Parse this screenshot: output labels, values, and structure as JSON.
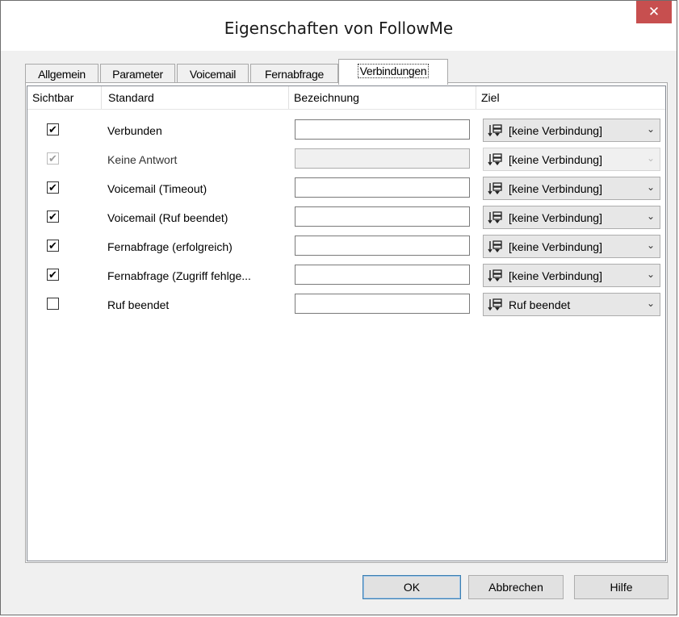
{
  "window": {
    "title": "Eigenschaften von FollowMe",
    "close_label": "✕"
  },
  "tabs": [
    {
      "label": "Allgemein"
    },
    {
      "label": "Parameter"
    },
    {
      "label": "Voicemail"
    },
    {
      "label": "Fernabfrage"
    },
    {
      "label": "Verbindungen"
    }
  ],
  "active_tab": "Verbindungen",
  "columns": {
    "visible": "Sichtbar",
    "standard": "Standard",
    "label": "Bezeichnung",
    "target": "Ziel"
  },
  "rows": [
    {
      "checked": true,
      "enabled": true,
      "check_mark": "✔",
      "standard": "Verbunden",
      "label_value": "",
      "target": "[keine Verbindung]"
    },
    {
      "checked": true,
      "enabled": false,
      "check_mark": "✔",
      "standard": "Keine Antwort",
      "label_value": "",
      "target": "[keine Verbindung]"
    },
    {
      "checked": true,
      "enabled": true,
      "check_mark": "✔",
      "standard": "Voicemail (Timeout)",
      "label_value": "",
      "target": "[keine Verbindung]"
    },
    {
      "checked": true,
      "enabled": true,
      "check_mark": "✔",
      "standard": "Voicemail (Ruf beendet)",
      "label_value": "",
      "target": "[keine Verbindung]"
    },
    {
      "checked": true,
      "enabled": true,
      "check_mark": "✔",
      "standard": "Fernabfrage (erfolgreich)",
      "label_value": "",
      "target": "[keine Verbindung]"
    },
    {
      "checked": true,
      "enabled": true,
      "check_mark": "✔",
      "standard": "Fernabfrage (Zugriff fehlge...",
      "label_value": "",
      "target": "[keine Verbindung]"
    },
    {
      "checked": false,
      "enabled": true,
      "check_mark": "",
      "standard": "Ruf beendet",
      "label_value": "",
      "target": "Ruf beendet"
    }
  ],
  "combo_icon": "connection-target-icon",
  "dropdown_arrow": "⌄",
  "buttons": {
    "ok": "OK",
    "cancel": "Abbrechen",
    "help": "Hilfe"
  },
  "colors": {
    "close_button": "#c74f4f",
    "default_button_border": "#3c7fb1"
  }
}
